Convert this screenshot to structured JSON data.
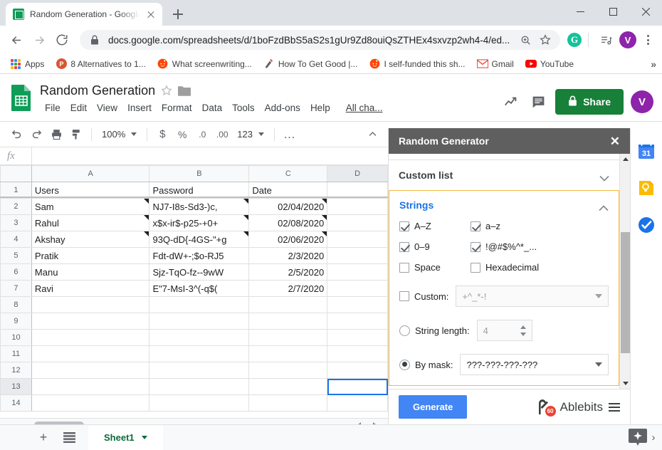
{
  "browser": {
    "tab": {
      "title": "Random Generation - Google Sh",
      "favicon": "sheets-icon",
      "close_label": "×"
    },
    "new_tab_label": "+",
    "window": {
      "minimize": "minimize-icon",
      "maximize": "maximize-icon",
      "close": "close-icon"
    },
    "nav": {
      "back": "back-arrow-icon",
      "forward": "forward-arrow-icon",
      "reload": "reload-icon"
    },
    "omnibox": {
      "lock": "lock-icon",
      "url": "docs.google.com/spreadsheets/d/1boFzdBbS5aS2s1gUr9Zd8ouiQsZTHEx4sxvzp2wh4-4/ed...",
      "zoom_icon": "zoom-in-icon",
      "bookmark_icon": "star-icon"
    },
    "extensions": {
      "grammarly": "G",
      "playlist": "playlist-icon",
      "avatar": "V",
      "menu": "kebab-menu-icon"
    },
    "bookmarks": [
      {
        "label": "Apps",
        "icon": "apps-grid-icon",
        "color": "#4285f4"
      },
      {
        "label": "8 Alternatives to 1...",
        "icon": "product-hunt-icon",
        "color": "#da552f",
        "glyph": "P"
      },
      {
        "label": "What screenwriting...",
        "icon": "reddit-icon",
        "color": "#ff4500",
        "glyph": "●"
      },
      {
        "label": "How To Get Good |...",
        "icon": "site-icon",
        "color": "#555555",
        "glyph": ""
      },
      {
        "label": "I self-funded this sh...",
        "icon": "reddit-icon",
        "color": "#ff4500",
        "glyph": "●"
      },
      {
        "label": "Gmail",
        "icon": "gmail-icon",
        "color": "#ea4335",
        "glyph": "M"
      },
      {
        "label": "YouTube",
        "icon": "youtube-icon",
        "color": "#ff0000",
        "glyph": "▶"
      }
    ],
    "bookmarks_overflow": "»"
  },
  "sheets": {
    "logo": "google-sheets-icon",
    "title": "Random Generation",
    "star_icon": "star-outline-icon",
    "folder_icon": "folder-icon",
    "menu": [
      "File",
      "Edit",
      "View",
      "Insert",
      "Format",
      "Data",
      "Tools",
      "Add-ons",
      "Help"
    ],
    "all_changes": "All cha...",
    "header_icons": [
      "trending-up-icon",
      "comment-icon"
    ],
    "share": {
      "label": "Share",
      "icon": "lock-icon",
      "color": "#188038"
    },
    "avatar": "V",
    "toolbar": {
      "undo": "undo-icon",
      "redo": "redo-icon",
      "print": "print-icon",
      "paint": "paint-format-icon",
      "zoom": "100%",
      "currency": "$",
      "percent": "%",
      "dec_decrease": ".0",
      "dec_increase": ".00",
      "number_format": "123",
      "more": "…",
      "collapse": "collapse-toolbar-icon"
    },
    "formula_bar": {
      "fx": "fx",
      "value": ""
    },
    "columns": [
      "A",
      "B",
      "C",
      "D"
    ],
    "selected_column": "D",
    "selected_row": "13",
    "selected_cell": "D13",
    "rows": [
      {
        "num": "1",
        "a": "Users",
        "b": "Password",
        "c": "Date",
        "d": "",
        "note": false
      },
      {
        "num": "2",
        "a": "Sam",
        "b": "NJ7-I8s-Sd3-)c,",
        "c": "02/04/2020",
        "d": "",
        "note": true
      },
      {
        "num": "3",
        "a": "Rahul",
        "b": "x$x-ir$-p25-+0+",
        "c": "02/08/2020",
        "d": "",
        "note": true
      },
      {
        "num": "4",
        "a": "Akshay",
        "b": "93Q-dD{-4GS-\"+g",
        "c": "02/06/2020",
        "d": "",
        "note": true
      },
      {
        "num": "5",
        "a": "Pratik",
        "b": "Fdt-dW+-;$o-RJ5",
        "c": "2/3/2020",
        "d": "",
        "note": false
      },
      {
        "num": "6",
        "a": "Manu",
        "b": "Sjz-TqO-fz--9wW",
        "c": "2/5/2020",
        "d": "",
        "note": false
      },
      {
        "num": "7",
        "a": "Ravi",
        "b": "E\"7-MsI-3^(-q$(",
        "c": "2/7/2020",
        "d": "",
        "note": false
      },
      {
        "num": "8",
        "a": "",
        "b": "",
        "c": "",
        "d": "",
        "note": false
      },
      {
        "num": "9",
        "a": "",
        "b": "",
        "c": "",
        "d": "",
        "note": false
      },
      {
        "num": "10",
        "a": "",
        "b": "",
        "c": "",
        "d": "",
        "note": false
      },
      {
        "num": "11",
        "a": "",
        "b": "",
        "c": "",
        "d": "",
        "note": false
      },
      {
        "num": "12",
        "a": "",
        "b": "",
        "c": "",
        "d": "",
        "note": false
      },
      {
        "num": "13",
        "a": "",
        "b": "",
        "c": "",
        "d": "",
        "note": false
      },
      {
        "num": "14",
        "a": "",
        "b": "",
        "c": "",
        "d": "",
        "note": false
      }
    ],
    "bottom": {
      "add_sheet": "+",
      "all_sheets": "all-sheets-icon",
      "sheet_name": "Sheet1",
      "explore": "explore-icon",
      "expand_chevron": "›"
    }
  },
  "addon": {
    "title": "Random Generator",
    "close": "✕",
    "sections": [
      {
        "name": "Custom list",
        "expanded": false
      },
      {
        "name": "Strings",
        "expanded": true
      }
    ],
    "strings": {
      "checkboxes": [
        {
          "label": "A–Z",
          "checked": true
        },
        {
          "label": "a–z",
          "checked": true
        },
        {
          "label": "0–9",
          "checked": true
        },
        {
          "label": "!@#$%^*_...",
          "checked": true
        },
        {
          "label": "Space",
          "checked": false
        },
        {
          "label": "Hexadecimal",
          "checked": false
        }
      ],
      "custom": {
        "label": "Custom:",
        "checked": false,
        "placeholder": "+^_*-!",
        "value": ""
      },
      "string_length": {
        "label": "String length:",
        "selected": false,
        "value": "4"
      },
      "by_mask": {
        "label": "By mask:",
        "selected": true,
        "value": "???-???-???-???"
      }
    },
    "footer": {
      "generate": "Generate",
      "brand": "Ablebits",
      "badge": "60",
      "menu": "hamburger-icon"
    }
  },
  "google_sidebar": [
    {
      "name": "google-calendar-icon",
      "label": "31"
    },
    {
      "name": "google-keep-icon",
      "label": ""
    },
    {
      "name": "google-tasks-icon",
      "label": ""
    }
  ]
}
